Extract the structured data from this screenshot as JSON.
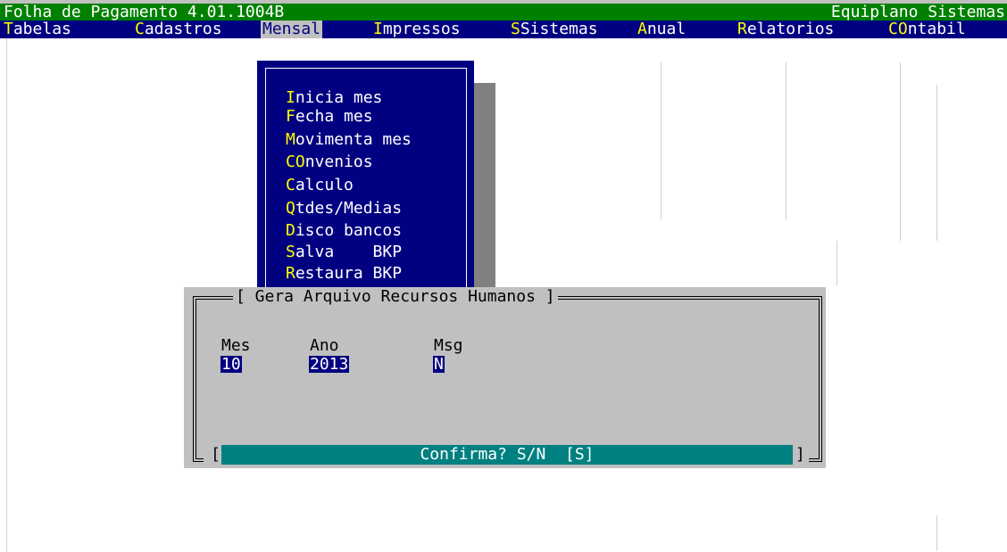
{
  "title_bar": {
    "left": "Folha de Pagamento 4.01.1004B",
    "right": "Equiplano Sistemas"
  },
  "menu": [
    {
      "hot": "T",
      "rest": "abelas"
    },
    {
      "hot": "C",
      "rest": "adastros"
    },
    {
      "hot": "",
      "rest": "Mensal"
    },
    {
      "hot": "I",
      "rest": "mpressos"
    },
    {
      "hot": "S",
      "rest": "Sistemas"
    },
    {
      "hot": "A",
      "rest": "nual"
    },
    {
      "hot": "R",
      "rest": "elatorios"
    },
    {
      "hot": "CO",
      "rest": "ntabil"
    }
  ],
  "mensal_menu": [
    {
      "hot": "I",
      "rest": "nicia mes"
    },
    {
      "hot": "F",
      "rest": "echa mes"
    },
    {
      "hot": "M",
      "rest": "ovimenta mes"
    },
    {
      "hot": "CO",
      "rest": "nvenios"
    },
    {
      "hot": "C",
      "rest": "alculo"
    },
    {
      "hot": "Q",
      "rest": "tdes/Medias"
    },
    {
      "hot": "D",
      "rest": "isco bancos"
    },
    {
      "hot": "S",
      "rest": "alva    BKP"
    },
    {
      "hot": "R",
      "rest": "estaura BKP"
    }
  ],
  "dialog": {
    "title": "[ Gera Arquivo Recursos Humanos ]",
    "fields": {
      "mes": {
        "label": "Mes",
        "value": "10"
      },
      "ano": {
        "label": "Ano",
        "value": "2013"
      },
      "msg": {
        "label": "Msg",
        "value": "N"
      }
    },
    "bracket_left": "[",
    "bracket_right": "]",
    "confirm": "Confirma? S/N  [S]"
  },
  "colors": {
    "title_bg": "#008000",
    "menu_bg": "#000080",
    "hotkey": "#ffff00",
    "dialog_bg": "#c0c0c0",
    "confirm_bg": "#008080"
  }
}
